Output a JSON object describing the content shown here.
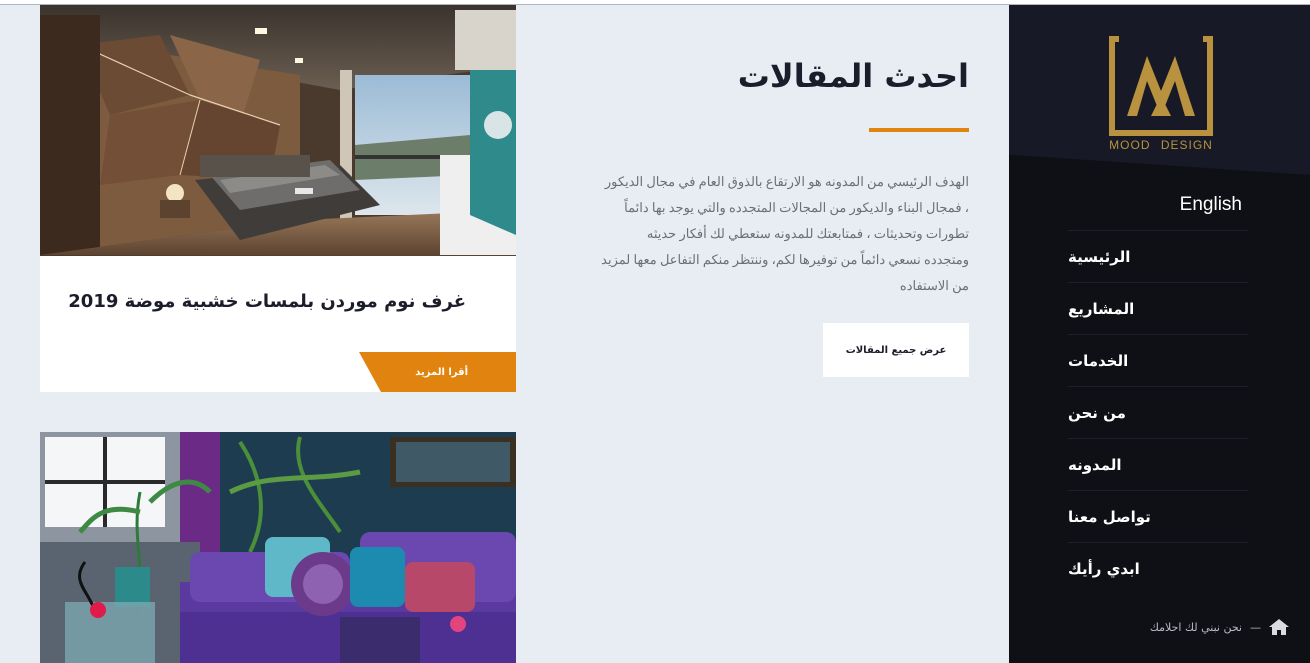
{
  "sidebar": {
    "logo_text": "MOOD  DESIGN",
    "nav": [
      {
        "label": "English"
      },
      {
        "label": "الرئيسية"
      },
      {
        "label": "المشاريع"
      },
      {
        "label": "الخدمات"
      },
      {
        "label": "من نحن"
      },
      {
        "label": "المدونه"
      },
      {
        "label": "تواصل معنا"
      },
      {
        "label": "ابدي رأيك"
      }
    ],
    "tagline": "نحن نبني لك احلامك",
    "tagline_separator": "—",
    "icon": "home-icon"
  },
  "intro": {
    "title": "احدث المقالات",
    "description": "الهدف الرئيسي من المدونه هو الارتقاع بالذوق العام في مجال الديكور ، فمجال البناء والديكور من المجالات المتجدده والتي يوجد بها دائماً تطورات وتحديثات ، فمتابعتك للمدونه ستعطي لك أفكار حديثه ومتجدده نسعي دائماً من توفيرها لكم، وننتظر منكم التفاعل معها لمزيد من الاستفاده",
    "all_button": "عرض جميع المقالات"
  },
  "articles": [
    {
      "title": "غرف نوم موردن بلمسات خشبية موضة 2019",
      "read_more": "أقرا المزيد"
    }
  ],
  "colors": {
    "accent": "#e0840f",
    "sidebar_bg": "#0f1015",
    "logo_gold": "#b8923e",
    "page_bg": "#e8edf4"
  }
}
